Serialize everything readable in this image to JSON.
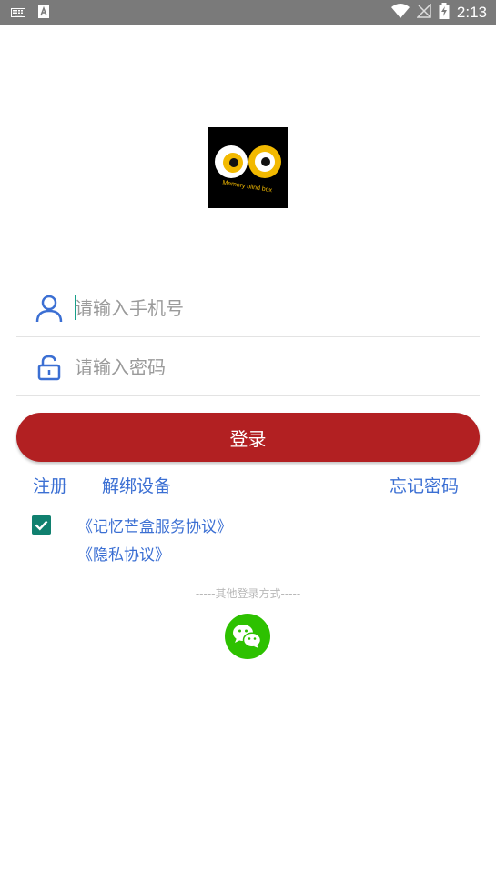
{
  "status_bar": {
    "time": "2:13",
    "icons": [
      "keyboard-icon",
      "a11y-icon",
      "wifi-icon",
      "no-signal-icon",
      "battery-charging-icon"
    ]
  },
  "logo": {
    "text": "Memory blind box"
  },
  "phone_field": {
    "placeholder": "请输入手机号",
    "icon": "user-icon"
  },
  "password_field": {
    "placeholder": "请输入密码",
    "icon": "lock-icon"
  },
  "login_button": {
    "label": "登录",
    "color": "#b22022"
  },
  "links": {
    "register": "注册",
    "unbind_device": "解绑设备",
    "forgot_password": "忘记密码"
  },
  "agreements": {
    "checked": true,
    "service_agreement": "《记忆芒盒服务协议》",
    "privacy_agreement": "《隐私协议》"
  },
  "other_login": {
    "divider_text": "-----其他登录方式-----",
    "wechat_icon": "wechat-icon"
  },
  "colors": {
    "accent": "#3b6fd3",
    "wechat": "#2dc100",
    "checkbox": "#10806f"
  }
}
